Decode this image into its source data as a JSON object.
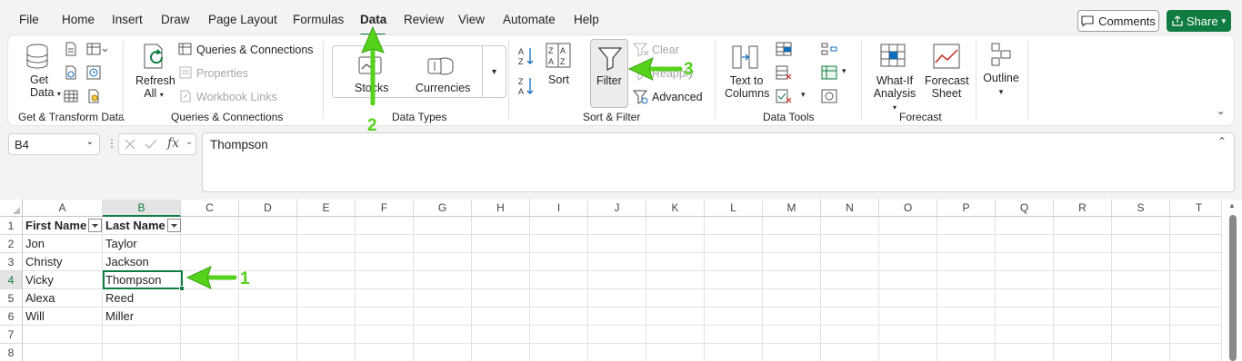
{
  "menu": {
    "tabs": [
      {
        "label": "File"
      },
      {
        "label": "Home"
      },
      {
        "label": "Insert"
      },
      {
        "label": "Draw"
      },
      {
        "label": "Page Layout"
      },
      {
        "label": "Formulas"
      },
      {
        "label": "Data"
      },
      {
        "label": "Review"
      },
      {
        "label": "View"
      },
      {
        "label": "Automate"
      },
      {
        "label": "Help"
      }
    ],
    "active_tab": "Data",
    "comments_label": "Comments",
    "share_label": "Share"
  },
  "ribbon": {
    "get_data": {
      "line1": "Get",
      "line2": "Data"
    },
    "get_transform_label": "Get & Transform Data",
    "refresh": {
      "line1": "Refresh",
      "line2": "All"
    },
    "queries_connections": "Queries & Connections",
    "properties": "Properties",
    "workbook_links": "Workbook Links",
    "queries_group_label": "Queries & Connections",
    "stocks": "Stocks",
    "currencies": "Currencies",
    "data_types_label": "Data Types",
    "sort": "Sort",
    "filter": "Filter",
    "clear": "Clear",
    "reapply": "Reapply",
    "advanced": "Advanced",
    "sort_filter_label": "Sort & Filter",
    "text_to_columns": {
      "line1": "Text to",
      "line2": "Columns"
    },
    "data_tools_label": "Data Tools",
    "what_if": {
      "line1": "What-If",
      "line2": "Analysis"
    },
    "forecast_sheet": {
      "line1": "Forecast",
      "line2": "Sheet"
    },
    "forecast_label": "Forecast",
    "outline": "Outline"
  },
  "formula_bar": {
    "name_box": "B4",
    "fx": "fx",
    "content": "Thompson"
  },
  "sheet": {
    "columns": [
      "A",
      "B",
      "C",
      "D",
      "E",
      "F",
      "G",
      "H",
      "I",
      "J",
      "K",
      "L",
      "M",
      "N",
      "O",
      "P",
      "Q",
      "R",
      "S",
      "T"
    ],
    "rows": [
      "1",
      "2",
      "3",
      "4",
      "5",
      "6",
      "7",
      "8"
    ],
    "data": [
      [
        "First Name",
        "Last Name"
      ],
      [
        "Jon",
        "Taylor"
      ],
      [
        "Christy",
        "Jackson"
      ],
      [
        "Vicky",
        "Thompson"
      ],
      [
        "Alexa",
        "Reed"
      ],
      [
        "Will",
        "Miller"
      ]
    ],
    "selected_cell": "B4"
  },
  "callouts": [
    "1",
    "2",
    "3"
  ],
  "colors": {
    "accent": "#107c41",
    "callout": "#55d21c"
  }
}
